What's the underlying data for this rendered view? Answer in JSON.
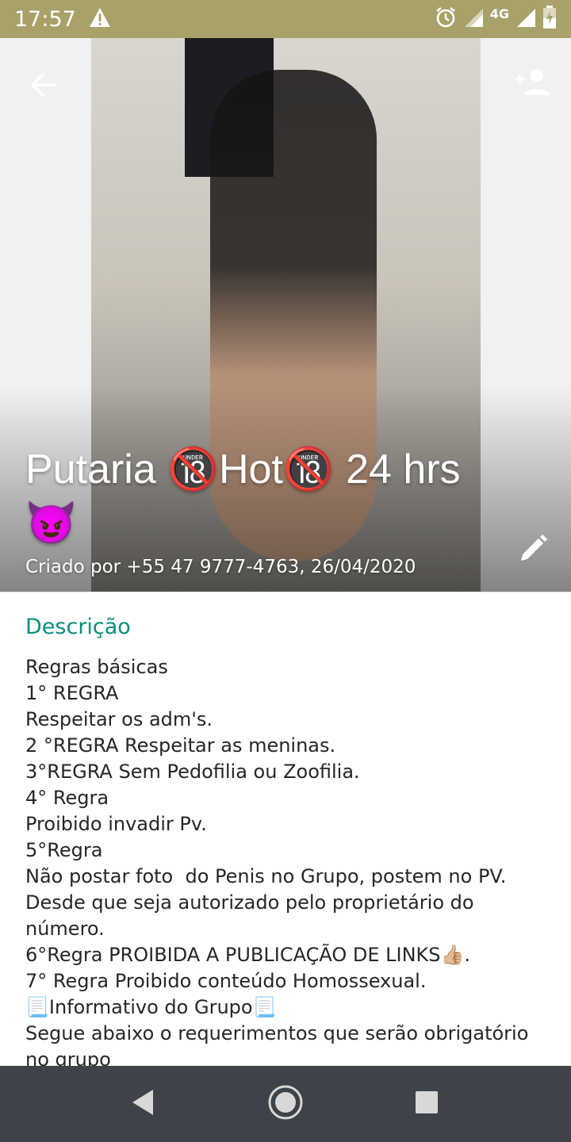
{
  "status_bar": {
    "time": "17:57",
    "network": "4G",
    "icons": [
      "warning-icon",
      "alarm-icon",
      "signal-icon",
      "battery-charging-icon"
    ]
  },
  "header": {
    "title": "Putaria 🔞Hot🔞 24 hrs 😈",
    "created_by": "Criado por +55 47 9777-4763, 26/04/2020",
    "icons": [
      "back-arrow-icon",
      "add-person-icon",
      "pencil-icon"
    ]
  },
  "description": {
    "label": "Descrição",
    "text": "Regras básicas\n1° REGRA\nRespeitar os adm's.\n2 °REGRA Respeitar as meninas.\n3°REGRA Sem Pedofilia ou Zoofilia.\n4° Regra\nProibido invadir Pv.\n5°Regra\nNão postar foto  do Penis no Grupo, postem no PV.\nDesde que seja autorizado pelo proprietário do número.\n6°Regra PROIBIDA A PUBLICAÇÃO DE LINKS👍🏼.\n7° Regra Proibido conteúdo Homossexual.\n📃Informativo do Grupo📃\nSegue abaixo o requerimentos que serão obrigatório no grupo"
  },
  "nav_bar": {
    "icons": [
      "nav-back-icon",
      "nav-home-icon",
      "nav-recents-icon"
    ]
  },
  "colors": {
    "status_bar": "#a9a16a",
    "accent": "#078f7c",
    "nav_bar": "#3e4349"
  }
}
